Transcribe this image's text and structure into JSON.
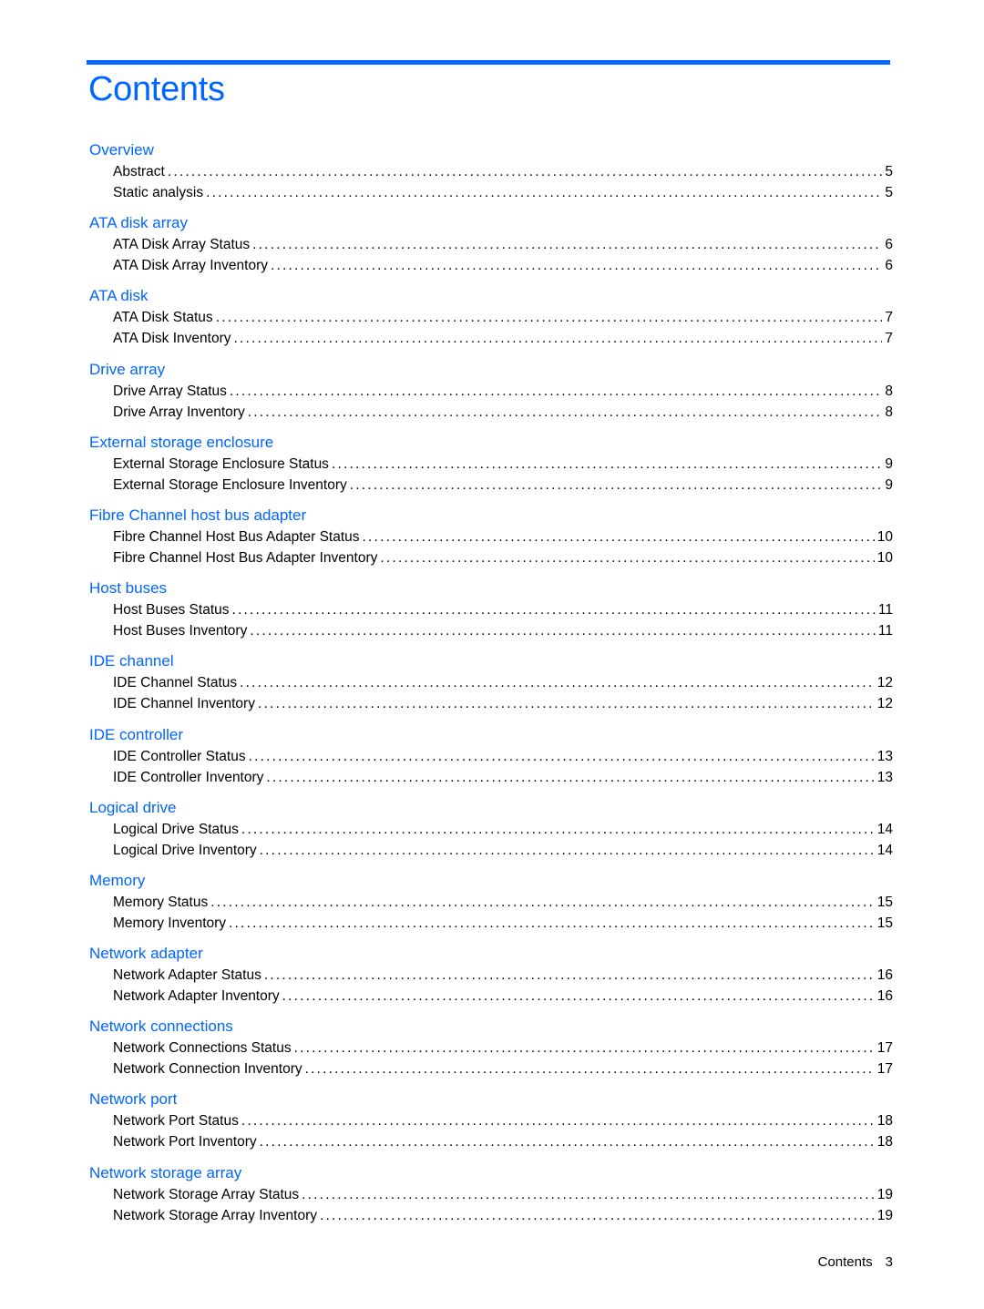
{
  "document": {
    "title": "Contents",
    "accent_color": "#0066ff",
    "sections": [
      {
        "title": "Overview",
        "entries": [
          {
            "label": "Abstract",
            "page": "5"
          },
          {
            "label": "Static analysis",
            "page": "5"
          }
        ]
      },
      {
        "title": "ATA disk array",
        "entries": [
          {
            "label": "ATA Disk Array Status",
            "page": "6"
          },
          {
            "label": "ATA Disk Array Inventory",
            "page": "6"
          }
        ]
      },
      {
        "title": "ATA disk",
        "entries": [
          {
            "label": "ATA Disk Status",
            "page": "7"
          },
          {
            "label": "ATA Disk Inventory",
            "page": "7"
          }
        ]
      },
      {
        "title": "Drive array",
        "entries": [
          {
            "label": "Drive Array Status",
            "page": "8"
          },
          {
            "label": "Drive Array Inventory",
            "page": "8"
          }
        ]
      },
      {
        "title": "External storage enclosure",
        "entries": [
          {
            "label": "External Storage Enclosure Status",
            "page": "9"
          },
          {
            "label": "External Storage Enclosure Inventory",
            "page": "9"
          }
        ]
      },
      {
        "title": "Fibre Channel host bus adapter",
        "entries": [
          {
            "label": "Fibre Channel Host Bus Adapter Status",
            "page": "10"
          },
          {
            "label": "Fibre Channel Host Bus Adapter Inventory",
            "page": "10"
          }
        ]
      },
      {
        "title": "Host buses",
        "entries": [
          {
            "label": "Host Buses Status",
            "page": "11"
          },
          {
            "label": "Host Buses Inventory",
            "page": "11"
          }
        ]
      },
      {
        "title": "IDE channel",
        "entries": [
          {
            "label": "IDE Channel Status",
            "page": "12"
          },
          {
            "label": "IDE Channel Inventory",
            "page": "12"
          }
        ]
      },
      {
        "title": "IDE controller",
        "entries": [
          {
            "label": "IDE Controller Status",
            "page": "13"
          },
          {
            "label": "IDE Controller Inventory",
            "page": "13"
          }
        ]
      },
      {
        "title": "Logical drive",
        "entries": [
          {
            "label": "Logical Drive Status",
            "page": "14"
          },
          {
            "label": "Logical Drive Inventory",
            "page": "14"
          }
        ]
      },
      {
        "title": "Memory",
        "entries": [
          {
            "label": "Memory Status",
            "page": "15"
          },
          {
            "label": "Memory Inventory",
            "page": "15"
          }
        ]
      },
      {
        "title": "Network adapter",
        "entries": [
          {
            "label": "Network Adapter Status",
            "page": "16"
          },
          {
            "label": "Network Adapter Inventory",
            "page": "16"
          }
        ]
      },
      {
        "title": "Network connections",
        "entries": [
          {
            "label": "Network Connections Status",
            "page": "17"
          },
          {
            "label": "Network Connection Inventory",
            "page": "17"
          }
        ]
      },
      {
        "title": "Network port",
        "entries": [
          {
            "label": "Network Port Status",
            "page": "18"
          },
          {
            "label": "Network Port Inventory",
            "page": "18"
          }
        ]
      },
      {
        "title": "Network storage array",
        "entries": [
          {
            "label": "Network Storage Array Status",
            "page": "19"
          },
          {
            "label": "Network Storage Array Inventory",
            "page": "19"
          }
        ]
      }
    ],
    "footer": {
      "label": "Contents",
      "page_number": "3"
    }
  }
}
